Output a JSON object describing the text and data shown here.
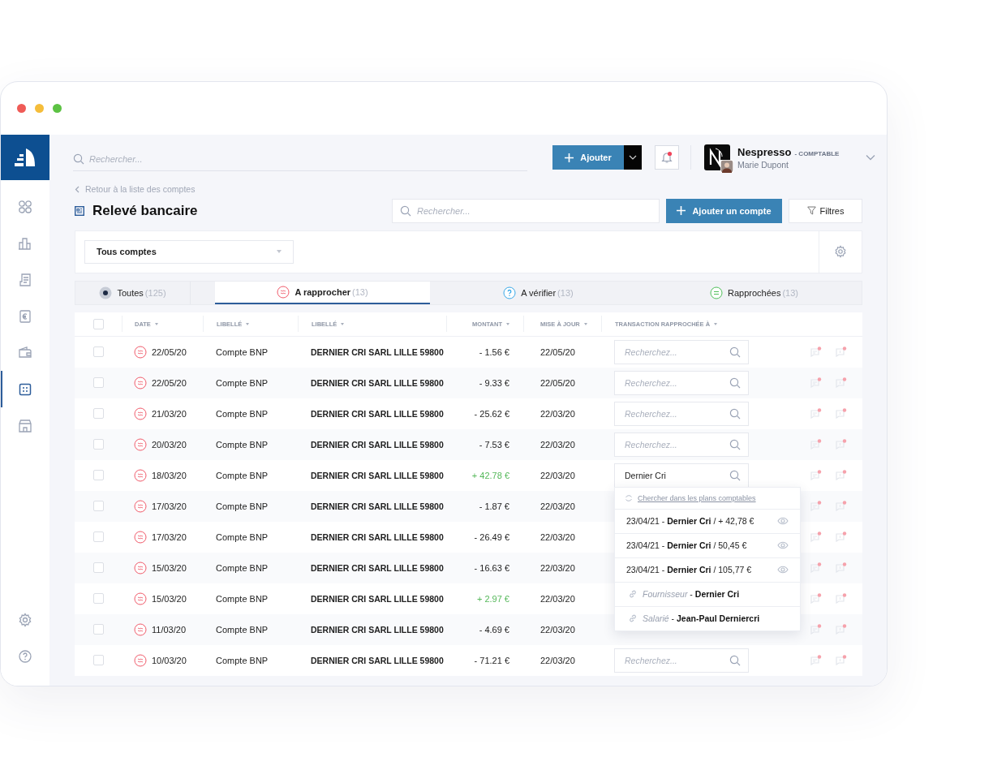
{
  "sidebar": {
    "items": [
      {
        "kind": "apps",
        "selected": false
      },
      {
        "kind": "chart",
        "selected": false
      },
      {
        "kind": "document",
        "selected": false
      },
      {
        "kind": "euro",
        "selected": false
      },
      {
        "kind": "wallet",
        "selected": false
      },
      {
        "kind": "calculator",
        "selected": true
      },
      {
        "kind": "shop",
        "selected": false
      }
    ],
    "bottom_items": [
      {
        "kind": "settings"
      },
      {
        "kind": "help"
      }
    ]
  },
  "topbar": {
    "search": {
      "placeholder": "Rechercher..."
    },
    "add_button": "Ajouter",
    "notifications": {
      "unread": true
    },
    "account": {
      "company": "Nespresso",
      "role": "- COMPTABLE",
      "user": "Marie Dupont"
    }
  },
  "page": {
    "back_link": "Retour à la liste des comptes",
    "title": "Relevé bancaire",
    "search": {
      "placeholder": "Rechercher..."
    },
    "add_account_button": "Ajouter un compte",
    "filters_button": "Filtres",
    "account_select": {
      "value": "Tous comptes"
    }
  },
  "tabs": [
    {
      "kind": "all",
      "label": "Toutes",
      "count": "(125)",
      "selected": false
    },
    {
      "kind": "pending",
      "label": "A rapprocher",
      "count": "(13)",
      "selected": true
    },
    {
      "kind": "verify",
      "label": "A vérifier",
      "count": "(13)",
      "selected": false
    },
    {
      "kind": "done",
      "label": "Rapprochées",
      "count": "(13)",
      "selected": false
    }
  ],
  "table": {
    "header_checkbox": {
      "checked": false
    },
    "columns": [
      {
        "label": "DATE"
      },
      {
        "label": "LIBELLÉ"
      },
      {
        "label": "LIBELLÉ"
      },
      {
        "label": "MONTANT"
      },
      {
        "label": "MISE À JOUR"
      },
      {
        "label": "TRANSACTION RAPPROCHÉE À"
      }
    ],
    "rows": [
      {
        "checked": false,
        "date": "22/05/20",
        "account": "Compte BNP",
        "label": "DERNIER CRI SARL LILLE 59800",
        "amount": "- 1.56 €",
        "credit": false,
        "updated": "22/05/20",
        "match": {
          "placeholder": "Recherchez..."
        }
      },
      {
        "checked": false,
        "date": "22/05/20",
        "account": "Compte BNP",
        "label": "DERNIER CRI SARL LILLE 59800",
        "amount": "- 9.33 €",
        "credit": false,
        "updated": "22/05/20",
        "match": {
          "placeholder": "Recherchez..."
        }
      },
      {
        "checked": false,
        "date": "21/03/20",
        "account": "Compte BNP",
        "label": "DERNIER CRI SARL LILLE 59800",
        "amount": "- 25.62 €",
        "credit": false,
        "updated": "22/03/20",
        "match": {
          "placeholder": "Recherchez..."
        }
      },
      {
        "checked": false,
        "date": "20/03/20",
        "account": "Compte BNP",
        "label": "DERNIER CRI SARL LILLE 59800",
        "amount": "- 7.53 €",
        "credit": false,
        "updated": "22/03/20",
        "match": {
          "placeholder": "Recherchez..."
        }
      },
      {
        "checked": false,
        "date": "18/03/20",
        "account": "Compte BNP",
        "label": "DERNIER CRI SARL LILLE 59800",
        "amount": "+ 42.78 €",
        "credit": true,
        "updated": "22/03/20",
        "match": {
          "value": "Dernier Cri"
        }
      },
      {
        "checked": false,
        "date": "17/03/20",
        "account": "Compte BNP",
        "label": "DERNIER CRI SARL LILLE 59800",
        "amount": "- 1.87 €",
        "credit": false,
        "updated": "22/03/20"
      },
      {
        "checked": false,
        "date": "17/03/20",
        "account": "Compte BNP",
        "label": "DERNIER CRI SARL LILLE 59800",
        "amount": "- 26.49 €",
        "credit": false,
        "updated": "22/03/20"
      },
      {
        "checked": false,
        "date": "15/03/20",
        "account": "Compte BNP",
        "label": "DERNIER CRI SARL LILLE 59800",
        "amount": "- 16.63 €",
        "credit": false,
        "updated": "22/03/20"
      },
      {
        "checked": false,
        "date": "15/03/20",
        "account": "Compte BNP",
        "label": "DERNIER CRI SARL LILLE 59800",
        "amount": "+ 2.97 €",
        "credit": true,
        "updated": "22/03/20"
      },
      {
        "checked": false,
        "date": "11/03/20",
        "account": "Compte BNP",
        "label": "DERNIER CRI SARL LILLE 59800",
        "amount": "- 4.69 €",
        "credit": false,
        "updated": "22/03/20"
      },
      {
        "checked": false,
        "date": "10/03/20",
        "account": "Compte BNP",
        "label": "DERNIER CRI SARL LILLE 59800",
        "amount": "- 71.21 €",
        "credit": false,
        "updated": "22/03/20",
        "match": {
          "placeholder": "Recherchez..."
        }
      }
    ]
  },
  "dropdown": {
    "search_link": "Chercher dans les plans comptables",
    "items": [
      {
        "kind": "transaction",
        "text": "23/04/21 - **Dernier Cri** / + 42,78 €"
      },
      {
        "kind": "transaction",
        "text": "23/04/21 - **Dernier Cri** / 50,45 €"
      },
      {
        "kind": "transaction",
        "text": "23/04/21 - **Dernier Cri** / 105,77 €"
      },
      {
        "kind": "link",
        "text": "*Fournisseur* - **Dernier Cri**"
      },
      {
        "kind": "link",
        "text": "*Salarié* - **Jean-Paul Derniercri**"
      }
    ]
  }
}
